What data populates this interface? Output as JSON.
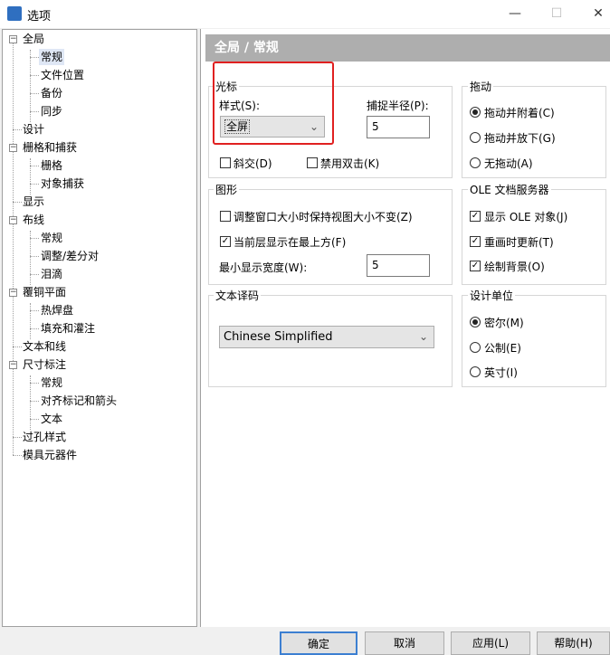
{
  "window": {
    "title": "选项",
    "minimize": "—",
    "maximize": "☐",
    "close": "✕"
  },
  "tree": {
    "items": [
      {
        "label": "全局"
      },
      {
        "label": "常规"
      },
      {
        "label": "文件位置"
      },
      {
        "label": "备份"
      },
      {
        "label": "同步"
      },
      {
        "label": "设计"
      },
      {
        "label": "栅格和捕获"
      },
      {
        "label": "栅格"
      },
      {
        "label": "对象捕获"
      },
      {
        "label": "显示"
      },
      {
        "label": "布线"
      },
      {
        "label": "常规"
      },
      {
        "label": "调整/差分对"
      },
      {
        "label": "泪滴"
      },
      {
        "label": "覆铜平面"
      },
      {
        "label": "热焊盘"
      },
      {
        "label": "填充和灌注"
      },
      {
        "label": "文本和线"
      },
      {
        "label": "尺寸标注"
      },
      {
        "label": "常规"
      },
      {
        "label": "对齐标记和箭头"
      },
      {
        "label": "文本"
      },
      {
        "label": "过孔样式"
      },
      {
        "label": "模具元器件"
      }
    ],
    "selected": "常规"
  },
  "header": {
    "title": "全局 / 常规"
  },
  "cursor": {
    "group_title": "光标",
    "style_label": "样式(S):",
    "style_value": "全屏",
    "snap_label": "捕捉半径(P):",
    "snap_value": "5",
    "diagonal_label": "斜交(D)",
    "diagonal_checked": false,
    "disable_dblclick_label": "禁用双击(K)",
    "disable_dblclick_checked": false
  },
  "drag": {
    "group_title": "拖动",
    "options": [
      "拖动并附着(C)",
      "拖动并放下(G)",
      "无拖动(A)"
    ],
    "selected_index": 0
  },
  "graphics": {
    "group_title": "图形",
    "keep_view_label": "调整窗口大小时保持视图大小不变(Z)",
    "keep_view_checked": false,
    "active_top_label": "当前层显示在最上方(F)",
    "active_top_checked": true,
    "min_width_label": "最小显示宽度(W):",
    "min_width_value": "5"
  },
  "ole": {
    "group_title": "OLE 文档服务器",
    "items": [
      {
        "label": "显示 OLE 对象(J)",
        "checked": true
      },
      {
        "label": "重画时更新(T)",
        "checked": true
      },
      {
        "label": "绘制背景(O)",
        "checked": true
      }
    ]
  },
  "text_encoding": {
    "group_title": "文本译码",
    "value": "Chinese Simplified"
  },
  "design_units": {
    "group_title": "设计单位",
    "options": [
      "密尔(M)",
      "公制(E)",
      "英寸(I)"
    ],
    "selected_index": 0
  },
  "buttons": {
    "ok": "确定",
    "cancel": "取消",
    "apply": "应用(L)",
    "help": "帮助(H)"
  },
  "colors": {
    "header_bg": "#aeaeae",
    "highlight": "#e02020",
    "selection": "#dfe7f5"
  }
}
